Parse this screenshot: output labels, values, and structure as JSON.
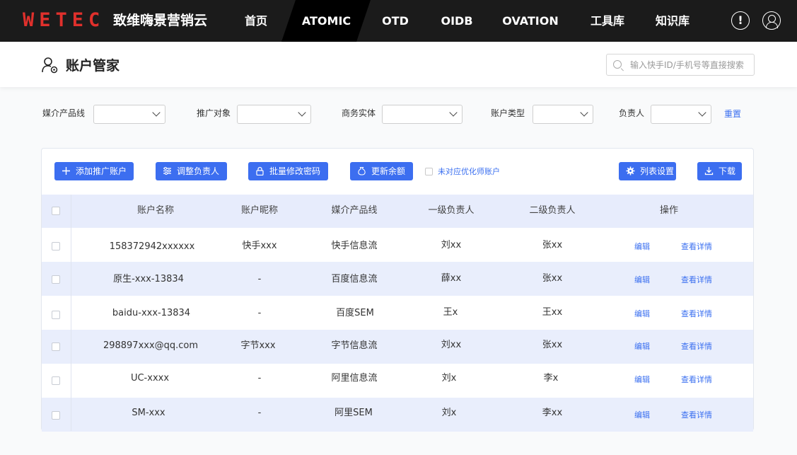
{
  "app": {
    "logo": "WETEC",
    "brand": "致维嗨景营销云",
    "nav": [
      "首页",
      "ATOMIC",
      "OTD",
      "OIDB",
      "OVATION",
      "工具库",
      "知识库"
    ],
    "active_nav": "ATOMIC",
    "alert_icon": "!"
  },
  "page": {
    "title": "账户管家",
    "search_placeholder": "输入快手ID/手机号等直接搜索"
  },
  "filters": {
    "labels": [
      "媒介产品线",
      "推广对象",
      "商务实体",
      "账户类型",
      "负责人"
    ],
    "reset": "重置"
  },
  "toolbar": {
    "add": "添加推广账户",
    "adjust": "调整负责人",
    "password": "批量修改密码",
    "balance": "更新余额",
    "unmatched": "未对应优化师账户",
    "columns": "列表设置",
    "download": "下载"
  },
  "table": {
    "headers": [
      "账户名称",
      "账户昵称",
      "媒介产品线",
      "一级负责人",
      "二级负责人",
      "操作"
    ],
    "rows": [
      {
        "name": "158372942xxxxxx",
        "nick": "快手xxx",
        "media": "快手信息流",
        "lead1": "刘xx",
        "lead2": "张xx"
      },
      {
        "name": "原生-xxx-13834",
        "nick": "-",
        "media": "百度信息流",
        "lead1": "薛xx",
        "lead2": "张xx"
      },
      {
        "name": "baidu-xxx-13834",
        "nick": "-",
        "media": "百度SEM",
        "lead1": "王x",
        "lead2": "王xx"
      },
      {
        "name": "298897xxx@qq.com",
        "nick": "字节xxx",
        "media": "字节信息流",
        "lead1": "刘xx",
        "lead2": "张xx"
      },
      {
        "name": "UC-xxxx",
        "nick": "-",
        "media": "阿里信息流",
        "lead1": "刘x",
        "lead2": "李x"
      },
      {
        "name": "SM-xxx",
        "nick": "-",
        "media": "阿里SEM",
        "lead1": "刘x",
        "lead2": "李xx"
      }
    ],
    "actions": {
      "edit": "编辑",
      "detail": "查看详情"
    }
  },
  "colors": {
    "primary": "#3c6ef0",
    "topbar": "#1b1b1b",
    "logo": "#e0302c",
    "row_alt": "#e9eefc"
  }
}
